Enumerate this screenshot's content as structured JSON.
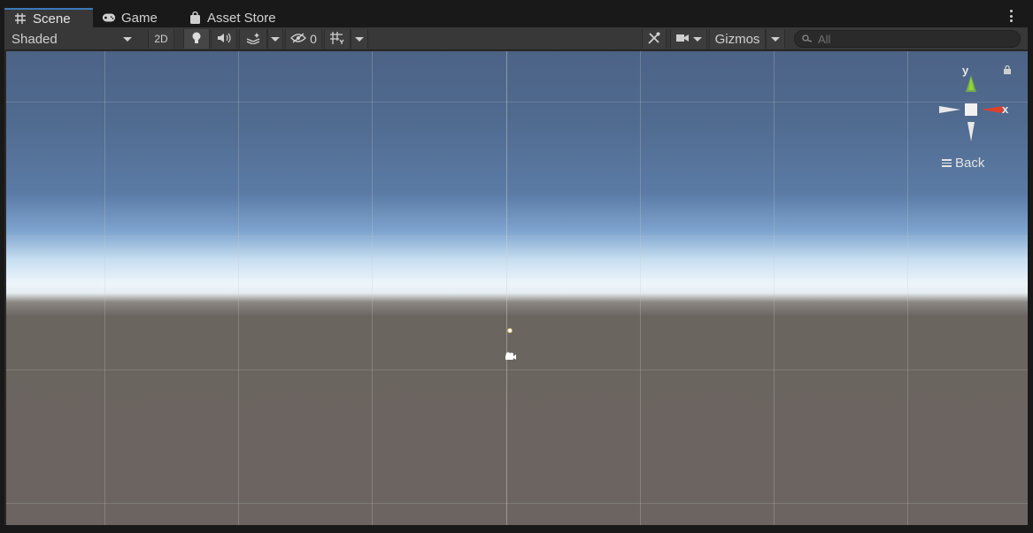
{
  "tabs": [
    {
      "label": "Scene",
      "icon": "grid-icon",
      "active": true
    },
    {
      "label": "Game",
      "icon": "gamepad-icon",
      "active": false
    },
    {
      "label": "Asset Store",
      "icon": "shopping-bag-icon",
      "active": false
    }
  ],
  "toolbar": {
    "draw_mode": "Shaded",
    "mode_2d": "2D",
    "hidden_count": "0",
    "gizmos_label": "Gizmos",
    "search_placeholder": "All"
  },
  "gizmo": {
    "y_label": "y",
    "x_label": "x",
    "view_label": "Back"
  },
  "colors": {
    "accent_tab": "#3a79bb",
    "axis_y": "#8fd630",
    "axis_x": "#e0402a"
  }
}
